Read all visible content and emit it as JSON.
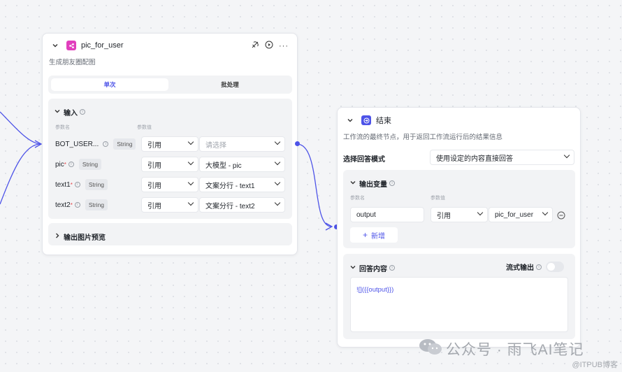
{
  "left_node": {
    "title": "pic_for_user",
    "description": "生成朋友圈配图",
    "tabs": [
      "单次",
      "批处理"
    ],
    "input_title": "输入",
    "col_param_name": "参数名",
    "col_param_value": "参数值",
    "params": [
      {
        "name": "BOT_USER...",
        "required": "",
        "type": "String",
        "source": "引用",
        "value": "请选择"
      },
      {
        "name": "pic",
        "required": "*",
        "type": "String",
        "source": "引用",
        "value": "大模型 - pic"
      },
      {
        "name": "text1",
        "required": "*",
        "type": "String",
        "source": "引用",
        "value": "文案分行 - text1"
      },
      {
        "name": "text2",
        "required": "*",
        "type": "String",
        "source": "引用",
        "value": "文案分行 - text2"
      }
    ],
    "preview_title": "输出图片预览"
  },
  "right_node": {
    "title": "结束",
    "description": "工作流的最终节点，用于返回工作流运行后的结果信息",
    "mode_label": "选择回答模式",
    "mode_value": "使用设定的内容直接回答",
    "output_vars_title": "输出变量",
    "col_param_name": "参数名",
    "col_param_value": "参数值",
    "output_var": {
      "name": "output",
      "source": "引用",
      "value": "pic_for_user"
    },
    "add_label": "新增",
    "answer_title": "回答内容",
    "stream_label": "流式输出",
    "stream_on": false,
    "answer_text": "![]({{output}})"
  },
  "watermark": {
    "main": "公众号 · 雨飞AI笔记",
    "sub": "@ITPUB博客"
  },
  "colors": {
    "accent": "#4d53e8",
    "plugin_icon": "#e13fbd",
    "end_icon": "#4d53e8"
  }
}
